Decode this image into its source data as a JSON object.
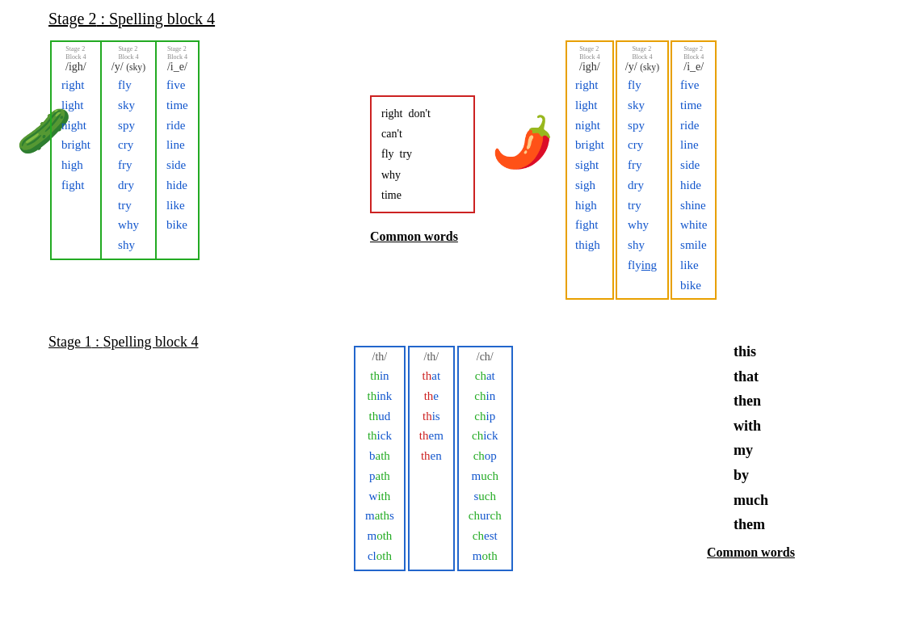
{
  "titles": {
    "stage2": "Stage 2",
    "colon": " : ",
    "spelling_block_4": " Spelling block 4",
    "stage1": "Stage 1"
  },
  "stage2_green": {
    "cards": [
      {
        "header": "Stage 2 Block 4",
        "phoneme": "/igh/",
        "words": [
          {
            "text": "right",
            "color": "blue"
          },
          {
            "text": "light",
            "color": "blue"
          },
          {
            "text": "night",
            "color": "blue"
          },
          {
            "text": "bright",
            "color": "blue"
          },
          {
            "text": "high",
            "color": "blue"
          },
          {
            "text": "fight",
            "color": "blue"
          }
        ]
      },
      {
        "header": "Stage 2 Block 4",
        "phoneme": "/y/ (sky)",
        "words": [
          {
            "text": "fly",
            "color": "blue"
          },
          {
            "text": "sky",
            "color": "blue"
          },
          {
            "text": "spy",
            "color": "blue"
          },
          {
            "text": "cry",
            "color": "blue"
          },
          {
            "text": "fry",
            "color": "blue"
          },
          {
            "text": "dry",
            "color": "blue"
          },
          {
            "text": "try",
            "color": "blue"
          },
          {
            "text": "why",
            "color": "blue"
          },
          {
            "text": "shy",
            "color": "blue"
          }
        ]
      },
      {
        "header": "Stage 2 Block 4",
        "phoneme": "/i_e/",
        "words": [
          {
            "text": "five",
            "color": "blue"
          },
          {
            "text": "time",
            "color": "blue"
          },
          {
            "text": "ride",
            "color": "blue"
          },
          {
            "text": "line",
            "color": "blue"
          },
          {
            "text": "side",
            "color": "blue"
          },
          {
            "text": "hide",
            "color": "blue"
          },
          {
            "text": "like",
            "color": "blue"
          },
          {
            "text": "bike",
            "color": "blue"
          }
        ]
      }
    ]
  },
  "stage2_common_words": {
    "title": "Common words",
    "words": [
      "right  don't",
      "can't",
      "fly  try",
      "why",
      "time"
    ]
  },
  "stage2_yellow": {
    "cards": [
      {
        "header": "Stage 2 Block 4",
        "phoneme": "/igh/",
        "words": [
          {
            "text": "right",
            "color": "blue"
          },
          {
            "text": "light",
            "color": "blue"
          },
          {
            "text": "night",
            "color": "blue"
          },
          {
            "text": "bright",
            "color": "blue"
          },
          {
            "text": "sight",
            "color": "blue"
          },
          {
            "text": "sigh",
            "color": "blue"
          },
          {
            "text": "high",
            "color": "blue"
          },
          {
            "text": "fight",
            "color": "blue"
          },
          {
            "text": "thigh",
            "color": "blue"
          }
        ]
      },
      {
        "header": "Stage 2 Block 4",
        "phoneme": "/y/ (sky)",
        "words": [
          {
            "text": "fly",
            "color": "blue"
          },
          {
            "text": "sky",
            "color": "blue"
          },
          {
            "text": "spy",
            "color": "blue"
          },
          {
            "text": "cry",
            "color": "blue"
          },
          {
            "text": "fry",
            "color": "blue"
          },
          {
            "text": "dry",
            "color": "blue"
          },
          {
            "text": "try",
            "color": "blue"
          },
          {
            "text": "why",
            "color": "blue"
          },
          {
            "text": "shy",
            "color": "blue"
          },
          {
            "text": "flying",
            "color": "blue"
          }
        ]
      },
      {
        "header": "Stage 2 Block 4",
        "phoneme": "/i_e/",
        "words": [
          {
            "text": "five",
            "color": "blue"
          },
          {
            "text": "time",
            "color": "blue"
          },
          {
            "text": "ride",
            "color": "blue"
          },
          {
            "text": "line",
            "color": "blue"
          },
          {
            "text": "side",
            "color": "blue"
          },
          {
            "text": "hide",
            "color": "blue"
          },
          {
            "text": "shine",
            "color": "blue"
          },
          {
            "text": "white",
            "color": "blue"
          },
          {
            "text": "smile",
            "color": "blue"
          },
          {
            "text": "like",
            "color": "blue"
          },
          {
            "text": "bike",
            "color": "blue"
          }
        ]
      }
    ]
  },
  "stage1_blue": {
    "cards": [
      {
        "phoneme": "/th/",
        "words": [
          {
            "text": "thi",
            "parts": [
              {
                "t": "th",
                "c": "green"
              },
              {
                "t": "in",
                "c": "blue"
              }
            ]
          },
          {
            "text": "think",
            "parts": [
              {
                "t": "th",
                "c": "green"
              },
              {
                "t": "ink",
                "c": "blue"
              }
            ]
          },
          {
            "text": "thud",
            "parts": [
              {
                "t": "th",
                "c": "green"
              },
              {
                "t": "ud",
                "c": "blue"
              }
            ]
          },
          {
            "text": "thick",
            "parts": [
              {
                "t": "th",
                "c": "green"
              },
              {
                "t": "ick",
                "c": "blue"
              }
            ]
          },
          {
            "text": "bath",
            "parts": [
              {
                "t": "b",
                "c": "blue"
              },
              {
                "t": "ath",
                "c": "green"
              }
            ]
          },
          {
            "text": "path",
            "parts": [
              {
                "t": "p",
                "c": "blue"
              },
              {
                "t": "ath",
                "c": "green"
              }
            ]
          },
          {
            "text": "with",
            "parts": [
              {
                "t": "w",
                "c": "blue"
              },
              {
                "t": "ith",
                "c": "green"
              }
            ]
          },
          {
            "text": "maths",
            "parts": [
              {
                "t": "m",
                "c": "blue"
              },
              {
                "t": "ath",
                "c": "green"
              },
              {
                "t": "s",
                "c": "blue"
              }
            ]
          },
          {
            "text": "moth",
            "parts": [
              {
                "t": "m",
                "c": "blue"
              },
              {
                "t": "oth",
                "c": "green"
              }
            ]
          },
          {
            "text": "cloth",
            "parts": [
              {
                "t": "cl",
                "c": "blue"
              },
              {
                "t": "oth",
                "c": "green"
              }
            ]
          }
        ]
      },
      {
        "phoneme": "/th/",
        "words": [
          {
            "text": "that",
            "parts": [
              {
                "t": "th",
                "c": "red"
              },
              {
                "t": "at",
                "c": "blue"
              }
            ]
          },
          {
            "text": "the",
            "parts": [
              {
                "t": "th",
                "c": "red"
              },
              {
                "t": "e",
                "c": "blue"
              }
            ]
          },
          {
            "text": "this",
            "parts": [
              {
                "t": "th",
                "c": "red"
              },
              {
                "t": "is",
                "c": "blue"
              }
            ]
          },
          {
            "text": "them",
            "parts": [
              {
                "t": "th",
                "c": "red"
              },
              {
                "t": "em",
                "c": "blue"
              }
            ]
          },
          {
            "text": "then",
            "parts": [
              {
                "t": "th",
                "c": "red"
              },
              {
                "t": "en",
                "c": "blue"
              }
            ]
          }
        ]
      },
      {
        "phoneme": "/ch/",
        "words": [
          {
            "text": "chat",
            "parts": [
              {
                "t": "ch",
                "c": "green"
              },
              {
                "t": "at",
                "c": "blue"
              }
            ]
          },
          {
            "text": "chin",
            "parts": [
              {
                "t": "ch",
                "c": "green"
              },
              {
                "t": "in",
                "c": "blue"
              }
            ]
          },
          {
            "text": "chip",
            "parts": [
              {
                "t": "ch",
                "c": "green"
              },
              {
                "t": "ip",
                "c": "blue"
              }
            ]
          },
          {
            "text": "chick",
            "parts": [
              {
                "t": "ch",
                "c": "green"
              },
              {
                "t": "ick",
                "c": "blue"
              }
            ]
          },
          {
            "text": "chop",
            "parts": [
              {
                "t": "ch",
                "c": "green"
              },
              {
                "t": "op",
                "c": "blue"
              }
            ]
          },
          {
            "text": "much",
            "parts": [
              {
                "t": "m",
                "c": "blue"
              },
              {
                "t": "uch",
                "c": "green"
              }
            ]
          },
          {
            "text": "such",
            "parts": [
              {
                "t": "s",
                "c": "blue"
              },
              {
                "t": "uch",
                "c": "green"
              }
            ]
          },
          {
            "text": "church",
            "parts": [
              {
                "t": "ch",
                "c": "green"
              },
              {
                "t": "ur",
                "c": "blue"
              },
              {
                "t": "ch",
                "c": "green"
              }
            ]
          },
          {
            "text": "chest",
            "parts": [
              {
                "t": "ch",
                "c": "green"
              },
              {
                "t": "est",
                "c": "blue"
              }
            ]
          },
          {
            "text": "moth",
            "parts": [
              {
                "t": "m",
                "c": "blue"
              },
              {
                "t": "oth",
                "c": "green"
              }
            ]
          }
        ]
      }
    ]
  },
  "stage1_common_words": {
    "label": "Common words",
    "words": [
      "this",
      "that",
      "then",
      "with",
      "my",
      "by",
      "much",
      "them"
    ]
  }
}
